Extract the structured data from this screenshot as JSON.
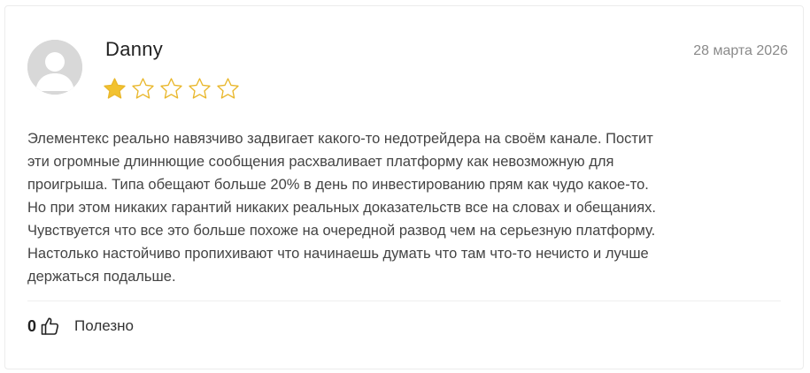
{
  "review": {
    "author": "Danny",
    "date": "28 марта 2026",
    "rating": 1,
    "max_rating": 5,
    "text": "Элементекс реально навязчиво задвигает какого-то недотрейдера на своём канале. Постит\nэти огромные длиннющие сообщения расхваливает платформу как невозможную для\nпроигрыша. Типа обещают больше 20% в день по инвестированию прям как чудо какое-то.\nНо при этом никаких гарантий никаких реальных доказательств все на словах и обещаниях.\nЧувствуется что все это больше похоже на очередной развод чем на серьезную платформу.\nНастолько настойчиво пропихивают что начинаешь думать что там что-то нечисто и лучше\nдержаться подальше."
  },
  "footer": {
    "likes_count": "0",
    "helpful_label": "Полезно",
    "like_icon": "thumbs-up-icon"
  },
  "colors": {
    "star_filled": "#f2c230",
    "star_empty_stroke": "#e9b72b",
    "avatar_bg": "#d8d8d8"
  }
}
